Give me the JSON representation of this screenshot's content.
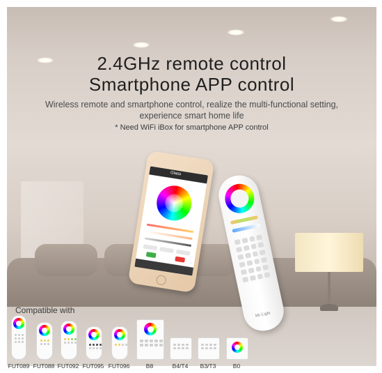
{
  "headline": {
    "line1": "2.4GHz remote control",
    "line2": "Smartphone APP control"
  },
  "description": {
    "line1": "Wireless remote and smartphone control, realize the multi-functional setting,",
    "line2": "experience smart home life",
    "note": "* Need WiFi iBox for smartphone APP control"
  },
  "phone_app": {
    "screen_title": "Glass"
  },
  "remote": {
    "brand": "Mi·Light"
  },
  "compatible": {
    "label": "Compatible with",
    "models": [
      "FUT089",
      "FUT088",
      "FUT092",
      "FUT095",
      "FUT096",
      "B8",
      "B4/T4",
      "B3/T3",
      "B0"
    ]
  },
  "colors": {
    "title": "#1f1f1f",
    "subtitle": "#4a4a4a",
    "rgb_wheel": "conic rainbow"
  }
}
